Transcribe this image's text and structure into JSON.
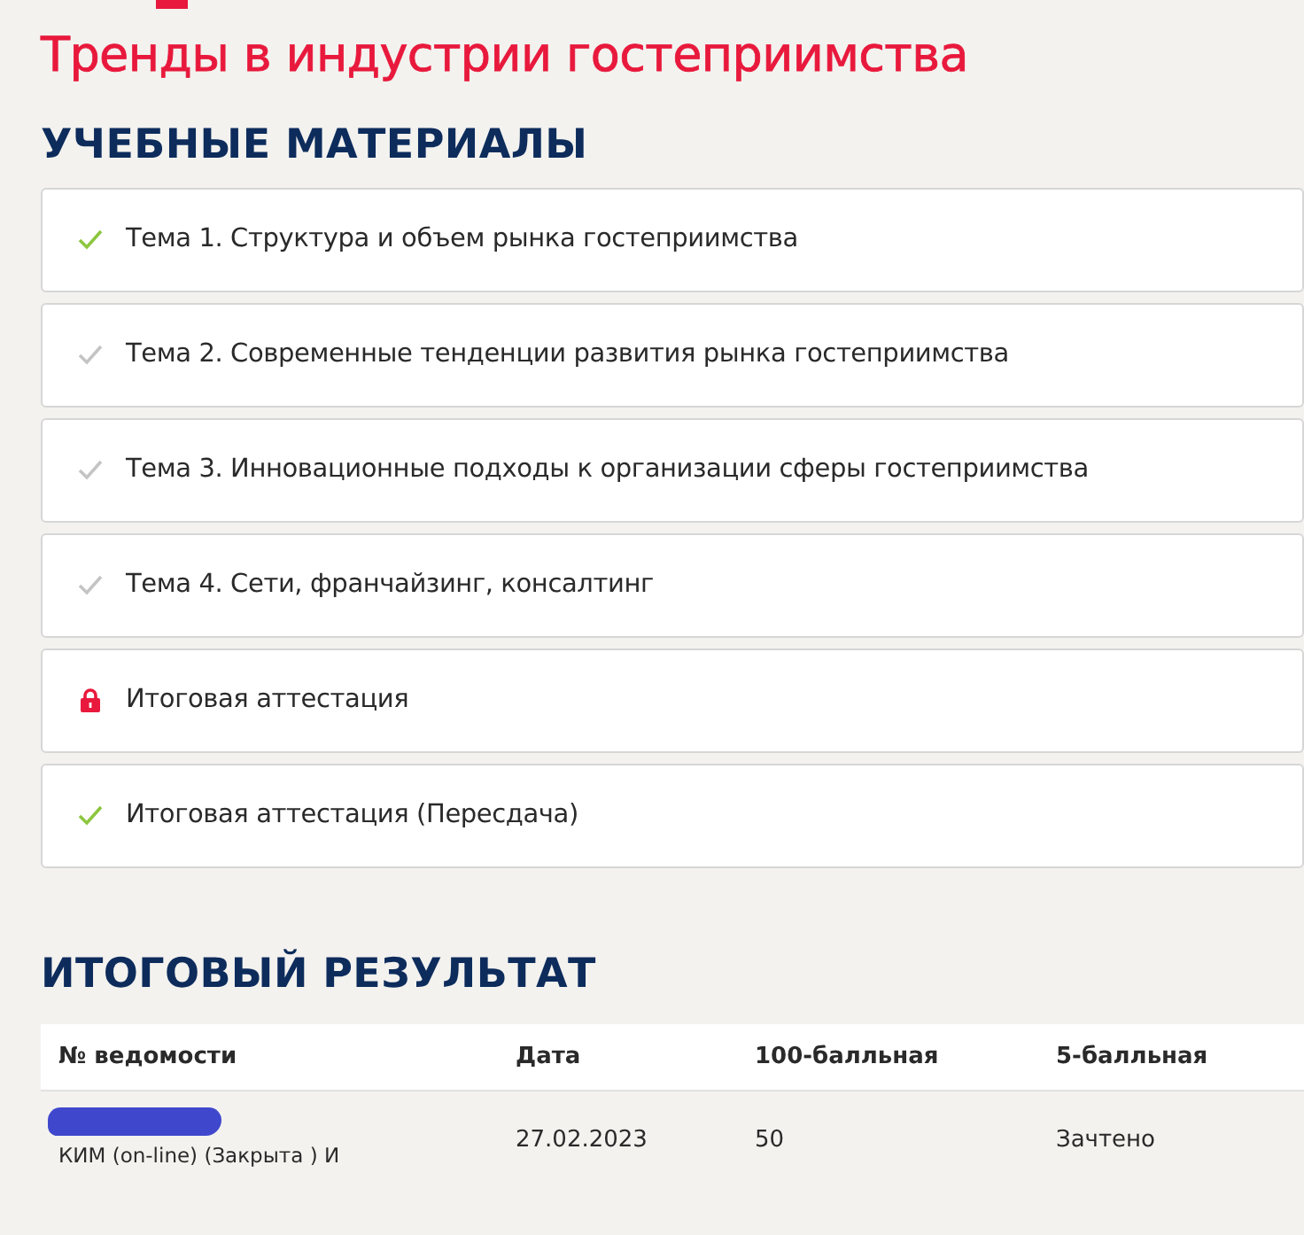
{
  "page_title": "Тренды в индустрии гостеприимства",
  "materials": {
    "heading": "УЧЕБНЫЕ МАТЕРИАЛЫ",
    "items": [
      {
        "label": "Тема 1. Структура и объем рынка гостеприимства",
        "kind": "check",
        "done": true
      },
      {
        "label": "Тема 2. Современные тенденции развития рынка гостеприимства",
        "kind": "check",
        "done": false
      },
      {
        "label": "Тема 3. Инновационные подходы к организации сферы гостеприимства",
        "kind": "check",
        "done": false
      },
      {
        "label": "Тема 4. Сети, франчайзинг, консалтинг",
        "kind": "check",
        "done": false
      },
      {
        "label": "Итоговая аттестация",
        "kind": "lock",
        "done": false
      },
      {
        "label": "Итоговая аттестация (Пересдача)",
        "kind": "check",
        "done": true
      }
    ]
  },
  "result": {
    "heading": "ИТОГОВЫЙ РЕЗУЛЬТАТ",
    "columns": [
      "№ ведомости",
      "Дата",
      "100-балльная",
      "5-балльная"
    ],
    "rows": [
      {
        "sheet": "КИМ (on-line) (Закрыта ) И",
        "redacted": true,
        "date": "27.02.2023",
        "score100": "50",
        "score5": "Зачтено"
      }
    ]
  }
}
